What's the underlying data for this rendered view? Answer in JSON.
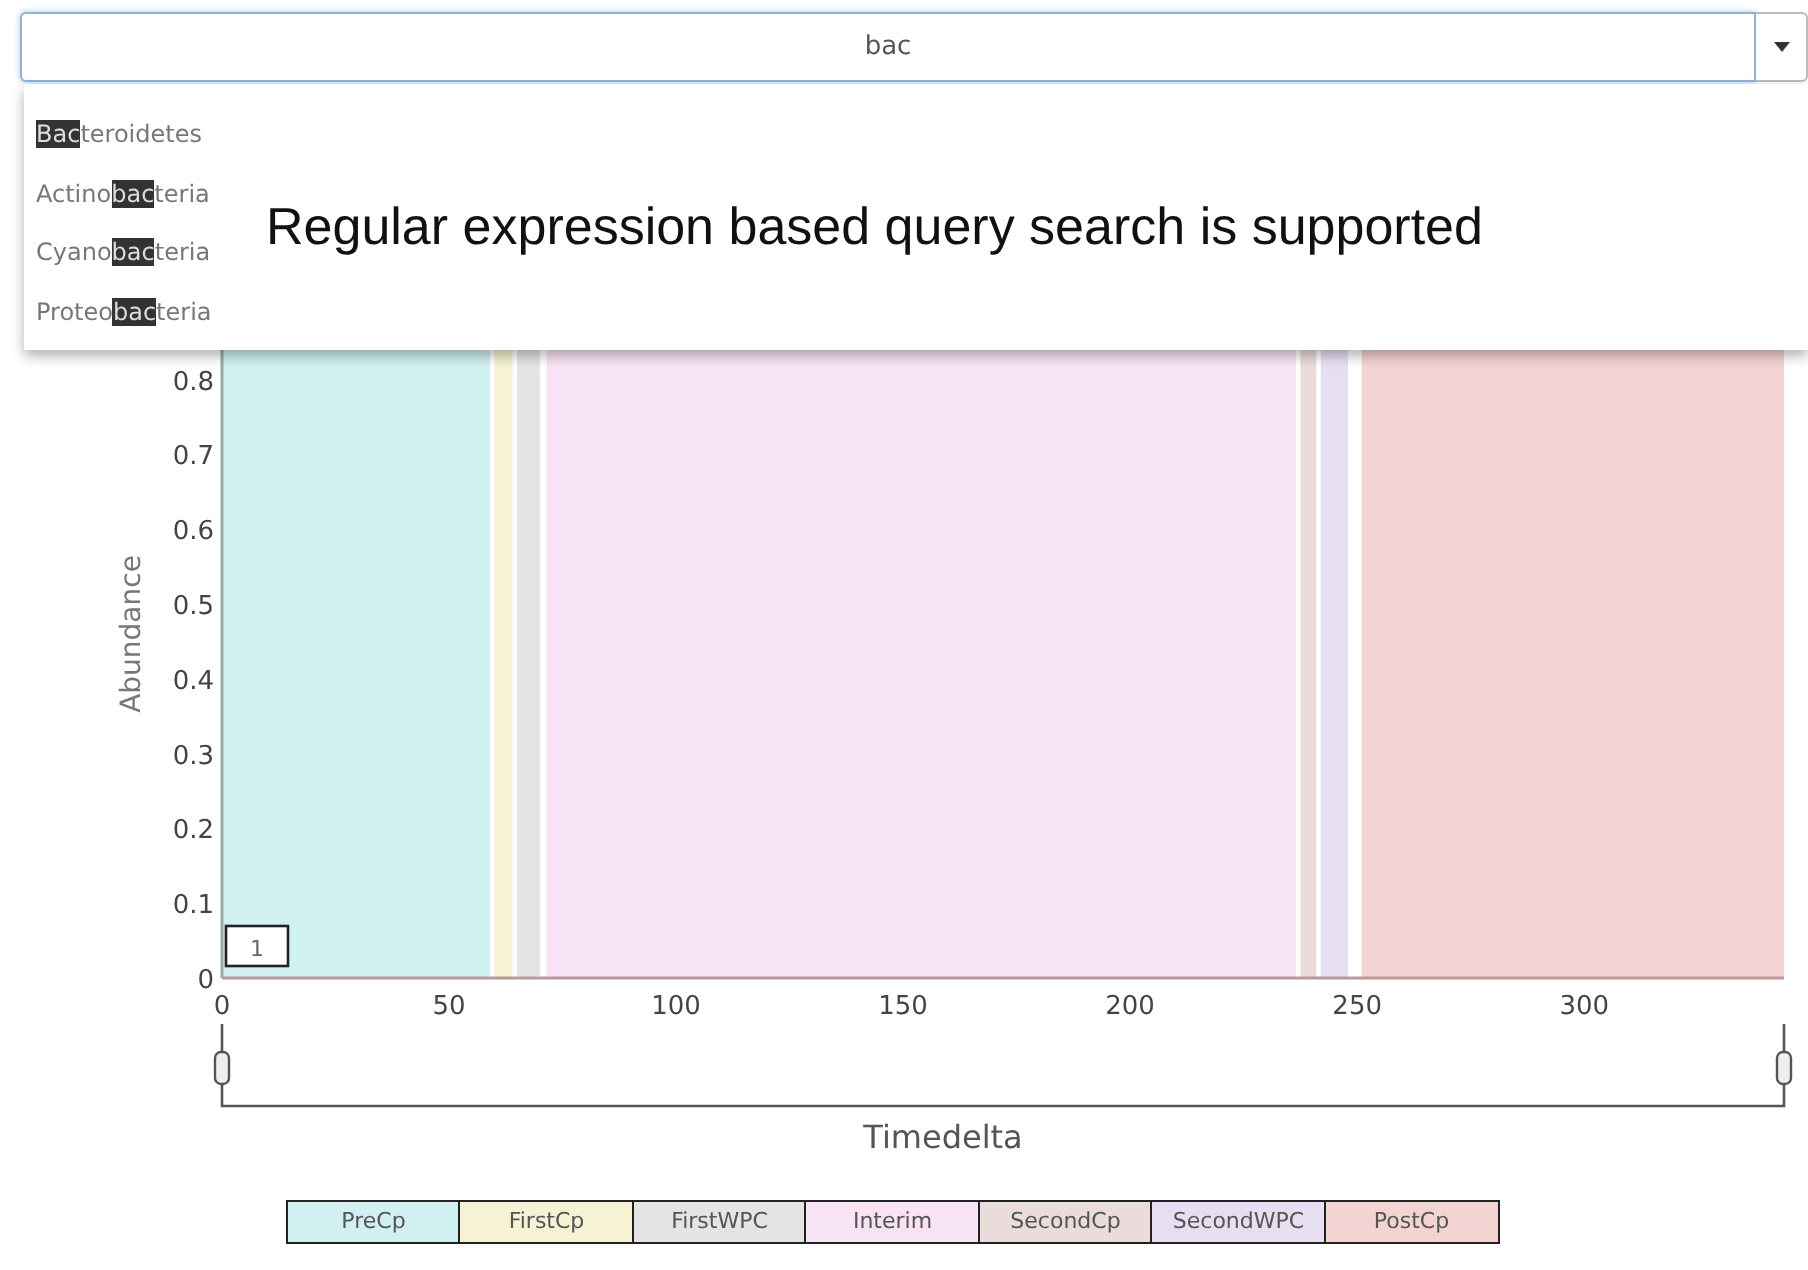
{
  "search": {
    "value": "bac"
  },
  "suggestions": [
    {
      "match": "Bac",
      "after": "teroidetes"
    },
    {
      "before": "Actino",
      "match": "bac",
      "after": "teria"
    },
    {
      "before": "Cyano",
      "match": "bac",
      "after": "teria"
    },
    {
      "before": "Proteo",
      "match": "bac",
      "after": "teria"
    }
  ],
  "caption": "Regular expression based query search is supported",
  "chart_data": {
    "type": "area",
    "xlabel": "Timedelta",
    "ylabel": "Abundance",
    "xlim": [
      0,
      344
    ],
    "ylim": [
      0,
      0.9
    ],
    "xticks": [
      0,
      50,
      100,
      150,
      200,
      250,
      300
    ],
    "yticks": [
      {
        "value": 0,
        "label": "0"
      },
      0.1,
      0.2,
      0.3,
      0.4,
      0.5,
      0.6,
      0.7,
      0.8
    ],
    "bands": [
      {
        "axis": "x",
        "from": 0,
        "to": 59,
        "color": "#d0f0f2"
      },
      {
        "axis": "x",
        "from": 60,
        "to": 64,
        "color": "#f5f3d3"
      },
      {
        "axis": "x",
        "from": 65,
        "to": 70,
        "color": "#e4e4e4"
      },
      {
        "axis": "x",
        "from": 71.5,
        "to": 236.5,
        "color": "#f7e3f3"
      },
      {
        "axis": "x",
        "from": 237.5,
        "to": 241,
        "color": "#e9dcda"
      },
      {
        "axis": "x",
        "from": 242,
        "to": 248,
        "color": "#e6dff1"
      },
      {
        "axis": "x",
        "from": 251,
        "to": 344,
        "color": "#f4d3d3"
      }
    ]
  },
  "marker_label": "1",
  "legend": [
    {
      "label": "PreCp",
      "color": "#d0f0f2"
    },
    {
      "label": "FirstCp",
      "color": "#f5f3d3"
    },
    {
      "label": "FirstWPC",
      "color": "#e4e4e4"
    },
    {
      "label": "Interim",
      "color": "#f7e3f3"
    },
    {
      "label": "SecondCp",
      "color": "#e9dcda"
    },
    {
      "label": "SecondWPC",
      "color": "#e6dff1"
    },
    {
      "label": "PostCp",
      "color": "#f4d3d3"
    }
  ]
}
